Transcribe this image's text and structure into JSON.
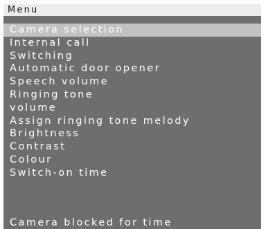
{
  "header": {
    "title": "Menu"
  },
  "menu": {
    "items": [
      {
        "label": "Camera selection",
        "selected": true
      },
      {
        "label": "Internal call",
        "selected": false
      },
      {
        "label": "Switching",
        "selected": false
      },
      {
        "label": "Automatic door opener",
        "selected": false
      },
      {
        "label": "Speech volume",
        "selected": false
      },
      {
        "label": "Ringing tone",
        "selected": false
      },
      {
        "label": "volume",
        "selected": false
      },
      {
        "label": "Assign ringing tone melody",
        "selected": false
      },
      {
        "label": "Brightness",
        "selected": false
      },
      {
        "label": "Contrast",
        "selected": false
      },
      {
        "label": "Colour",
        "selected": false
      },
      {
        "label": "Switch-on time",
        "selected": false
      }
    ]
  },
  "footer": {
    "status": "Camera blocked for time"
  },
  "colors": {
    "background": "#6e6e6e",
    "header": "#ececec",
    "selection": "#c2c2c2",
    "text": "#ffffff"
  }
}
